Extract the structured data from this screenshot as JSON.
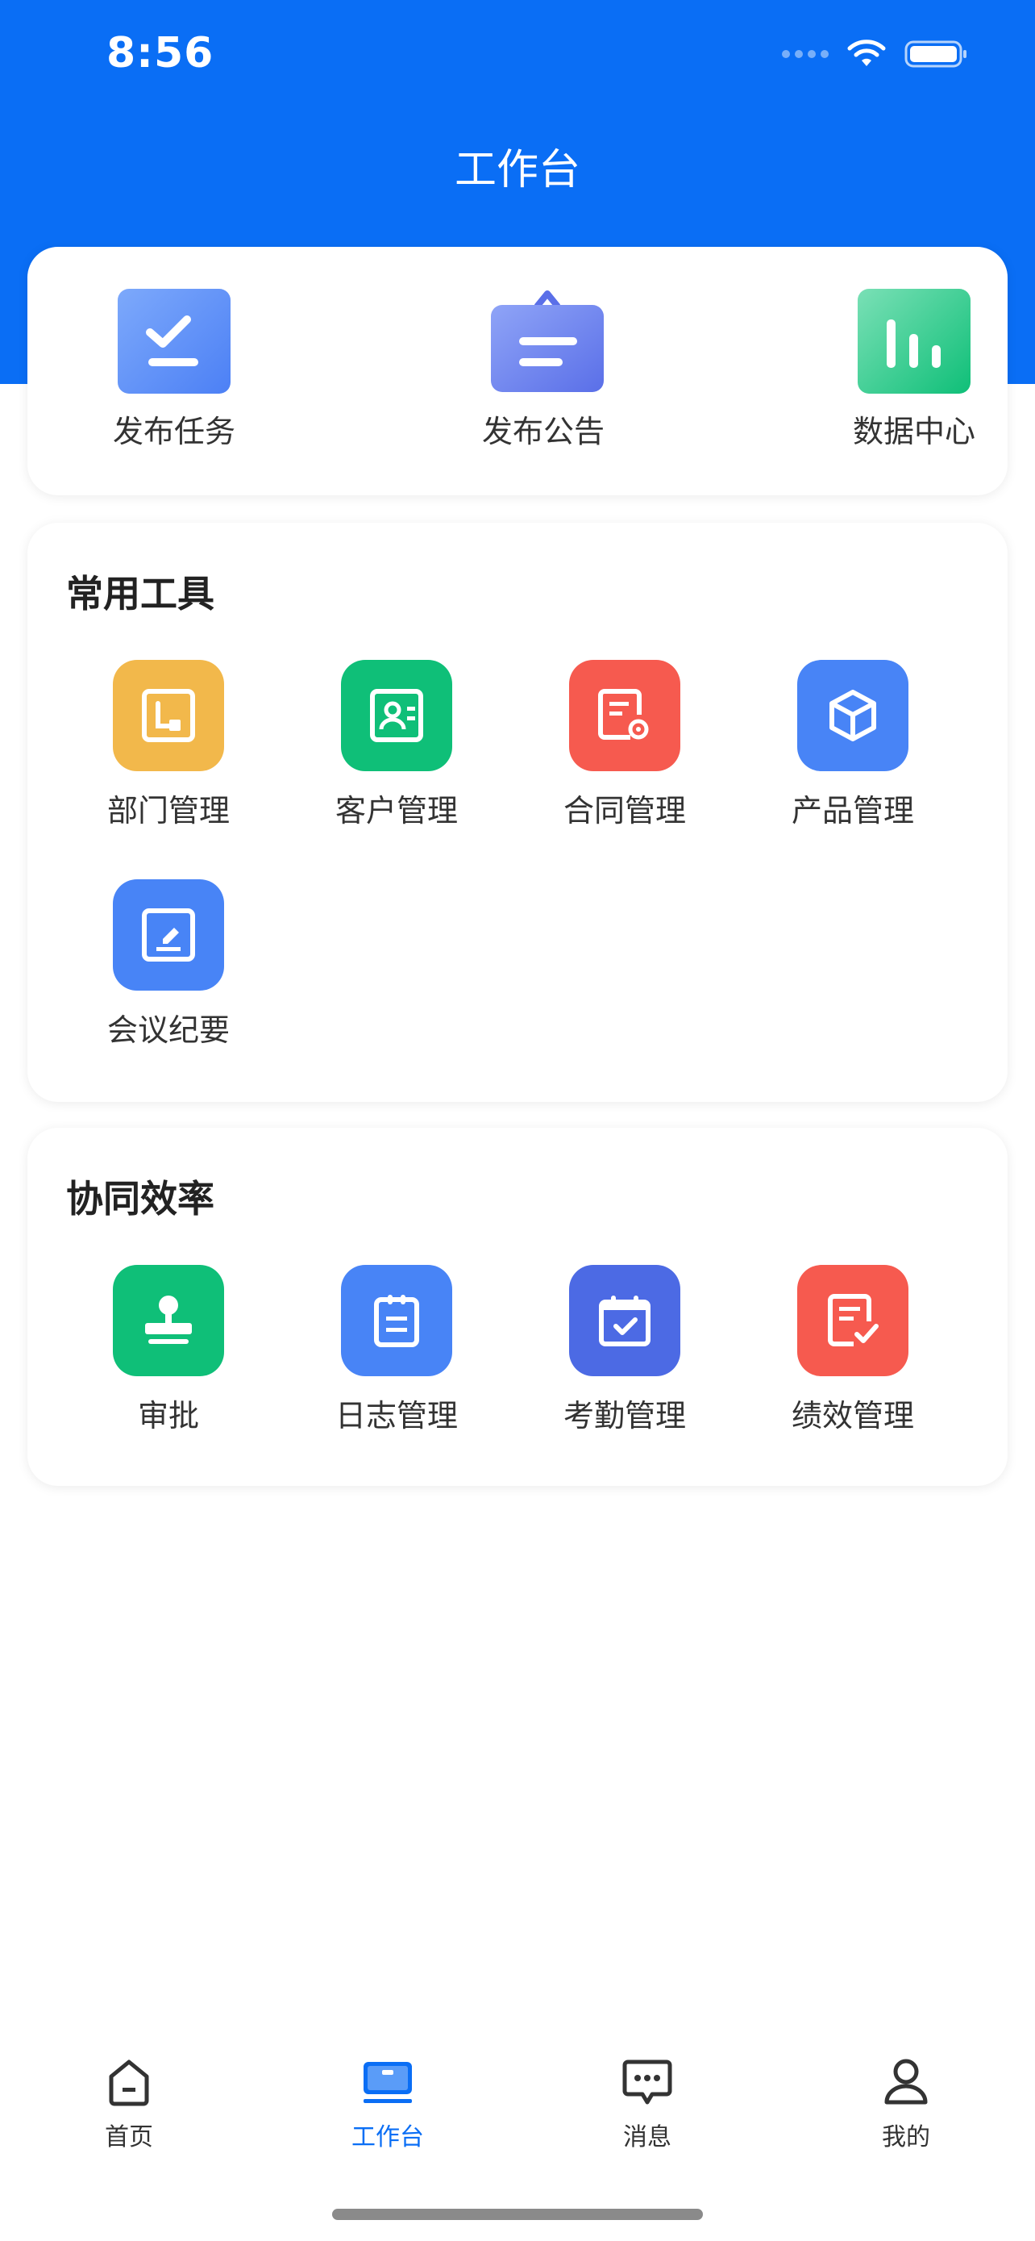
{
  "status_bar": {
    "time": "8:56"
  },
  "header": {
    "title": "工作台"
  },
  "quick_actions": [
    {
      "label": "发布任务",
      "icon": "task-check-icon"
    },
    {
      "label": "发布公告",
      "icon": "announcement-icon"
    },
    {
      "label": "数据中心",
      "icon": "bar-chart-icon"
    }
  ],
  "common_tools": {
    "title": "常用工具",
    "items": [
      {
        "label": "部门管理",
        "icon": "department-icon",
        "color": "#f2b84b"
      },
      {
        "label": "客户管理",
        "icon": "customer-card-icon",
        "color": "#0fbf78"
      },
      {
        "label": "合同管理",
        "icon": "contract-icon",
        "color": "#f65a4f"
      },
      {
        "label": "产品管理",
        "icon": "product-box-icon",
        "color": "#4884f6"
      },
      {
        "label": "会议纪要",
        "icon": "meeting-notes-icon",
        "color": "#4884f6"
      }
    ]
  },
  "collaboration": {
    "title": "协同效率",
    "items": [
      {
        "label": "审批",
        "icon": "stamp-icon",
        "color": "#0fbf78"
      },
      {
        "label": "日志管理",
        "icon": "log-clipboard-icon",
        "color": "#4884f6"
      },
      {
        "label": "考勤管理",
        "icon": "attendance-calendar-icon",
        "color": "#4c6ae4"
      },
      {
        "label": "绩效管理",
        "icon": "performance-check-icon",
        "color": "#f65a4f"
      }
    ]
  },
  "tabbar": {
    "items": [
      {
        "label": "首页",
        "icon": "home-icon",
        "active": false
      },
      {
        "label": "工作台",
        "icon": "workbench-icon",
        "active": true
      },
      {
        "label": "消息",
        "icon": "message-icon",
        "active": false
      },
      {
        "label": "我的",
        "icon": "profile-icon",
        "active": false
      }
    ]
  },
  "colors": {
    "brand": "#0a6ef5"
  }
}
